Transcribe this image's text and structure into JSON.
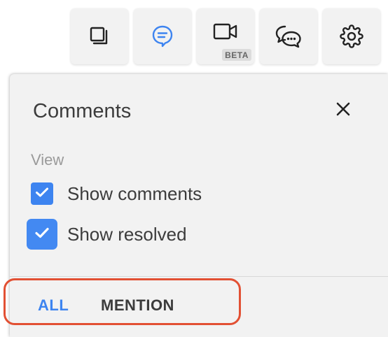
{
  "toolbar": {
    "buttons": [
      {
        "icon": "pages-icon"
      },
      {
        "icon": "comment-icon",
        "active": true,
        "color": "#3d84f0"
      },
      {
        "icon": "video-camera-icon",
        "badge": "BETA"
      },
      {
        "icon": "chat-bubbles-icon"
      },
      {
        "icon": "gear-icon"
      }
    ]
  },
  "panel": {
    "title": "Comments",
    "close_icon": "close-icon",
    "view_label": "View",
    "options": [
      {
        "label": "Show comments",
        "checked": true
      },
      {
        "label": "Show resolved",
        "checked": true
      }
    ],
    "tabs": [
      {
        "label": "ALL",
        "active": true
      },
      {
        "label": "MENTION",
        "active": false
      }
    ]
  },
  "colors": {
    "accent": "#3d84f0",
    "highlight": "#e25033",
    "panel_bg": "#f2f2f2",
    "text": "#3c3c3c"
  }
}
